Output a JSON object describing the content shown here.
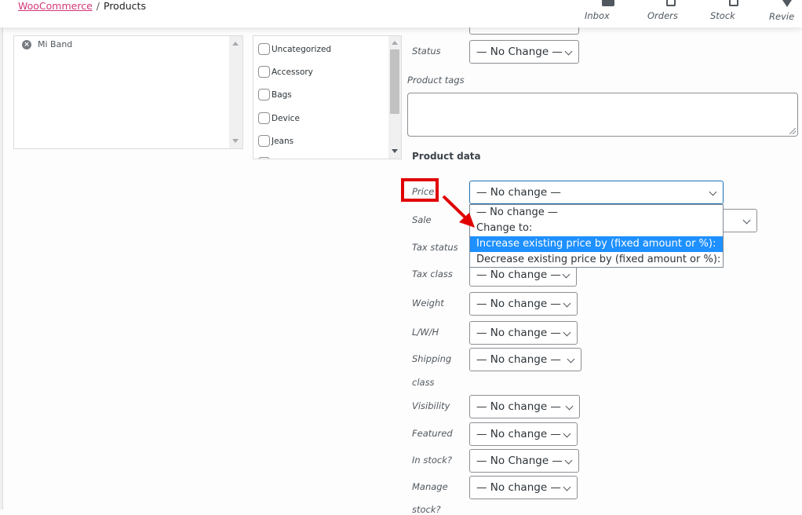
{
  "header": {
    "breadcrumb": {
      "parent": "WooCommerce",
      "separator": "/",
      "current": "Products"
    },
    "nav": [
      {
        "label": "Inbox",
        "icon": "inbox-icon"
      },
      {
        "label": "Orders",
        "icon": "orders-icon"
      },
      {
        "label": "Stock",
        "icon": "stock-icon"
      },
      {
        "label": "Revie",
        "icon": "star-icon"
      }
    ]
  },
  "products_selector": {
    "selected": [
      {
        "label": "Mi Band",
        "remove_icon": "close-circle-icon"
      }
    ]
  },
  "categories": {
    "items": [
      {
        "label": "Uncategorized",
        "checked": false
      },
      {
        "label": "Accessory",
        "checked": false
      },
      {
        "label": "Bags",
        "checked": false
      },
      {
        "label": "Device",
        "checked": false
      },
      {
        "label": "Jeans",
        "checked": false
      }
    ]
  },
  "form": {
    "status": {
      "label": "Status",
      "value": "— No Change —"
    },
    "product_tags": {
      "label": "Product tags",
      "value": ""
    },
    "product_data_title": "Product data",
    "price": {
      "label": "Price",
      "value": "— No change —",
      "options": [
        "— No change —",
        "Change to:",
        "Increase existing price by (fixed amount or %):",
        "Decrease existing price by (fixed amount or %):"
      ],
      "highlighted_option_index": 2
    },
    "sale": {
      "label": "Sale"
    },
    "tax_status": {
      "label": "Tax status"
    },
    "tax_class": {
      "label": "Tax class",
      "value": "— No change —"
    },
    "weight": {
      "label": "Weight",
      "value": "— No change —"
    },
    "lwh": {
      "label": "L/W/H",
      "value": "— No change —"
    },
    "shipping_class": {
      "label_line1": "Shipping",
      "label_line2": "class",
      "value": "— No change —"
    },
    "visibility": {
      "label": "Visibility",
      "value": "— No change —"
    },
    "featured": {
      "label": "Featured",
      "value": "— No change —"
    },
    "in_stock": {
      "label": "In stock?",
      "value": "— No Change —"
    },
    "manage_stock": {
      "label_line1": "Manage",
      "label_line2": "stock?",
      "value": "— No change —"
    }
  },
  "annotation": {
    "color": "#e00000",
    "target": "Price"
  },
  "colors": {
    "brand_link": "#d33779",
    "focus": "#2271b1",
    "option_highlight": "#1e90ff"
  }
}
